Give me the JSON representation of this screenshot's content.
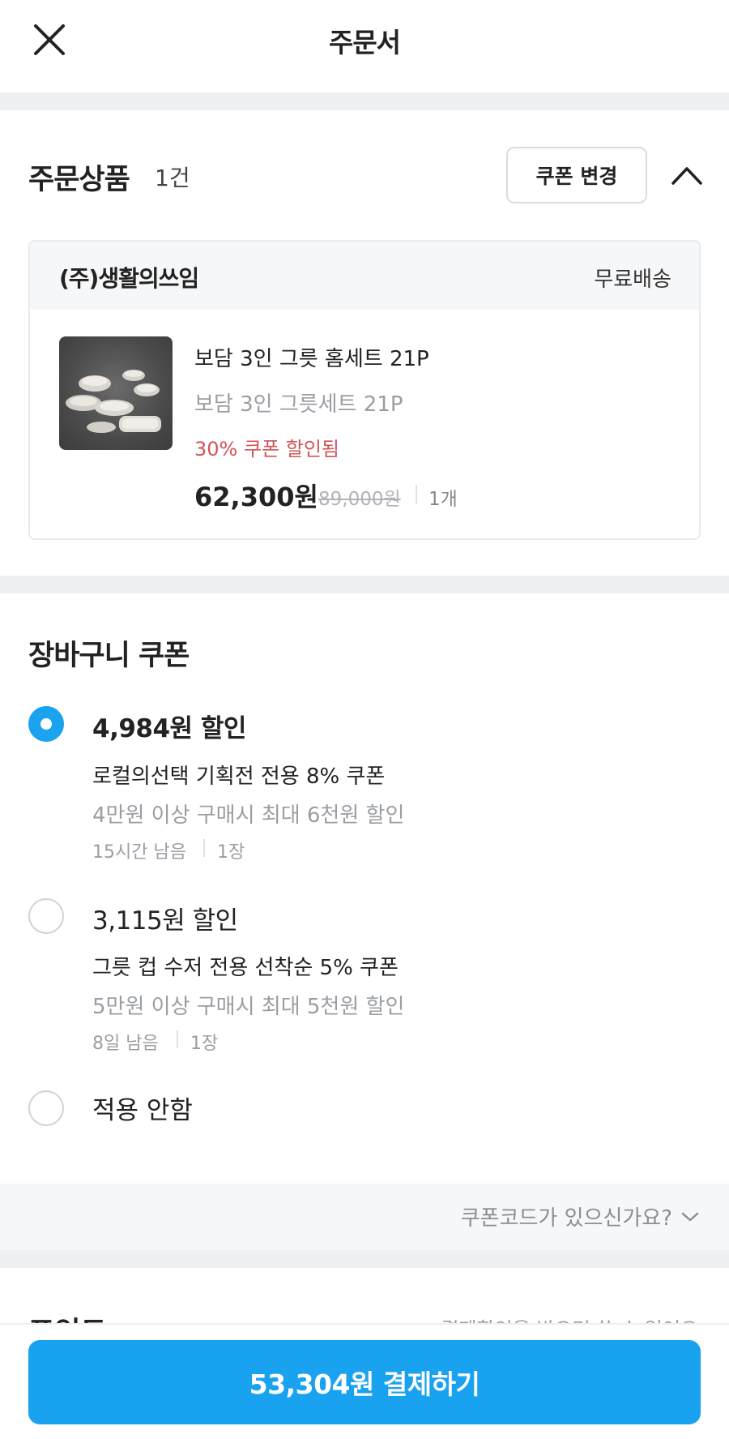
{
  "header": {
    "title": "주문서",
    "close_icon": "close-icon"
  },
  "order_product": {
    "title": "주문상품",
    "count": "1건",
    "coupon_change_label": "쿠폰 변경",
    "collapse_icon": "chevron-up-icon",
    "seller": "(주)생활의쓰임",
    "shipping": "무료배송",
    "item": {
      "name": "보담 3인 그릇 홈세트 21P",
      "option": "보담 3인 그릇세트 21P",
      "discount_note": "30% 쿠폰 할인됨",
      "price": "62,300원",
      "original_price": "89,000원",
      "quantity": "1개"
    }
  },
  "cart_coupon": {
    "title": "장바구니 쿠폰",
    "options": [
      {
        "amount": "4,984원 할인",
        "name": "로컬의선택 기획전 전용 8% 쿠폰",
        "condition": "4만원 이상 구매시 최대 6천원 할인",
        "remaining": "15시간 남음",
        "count": "1장",
        "selected": true
      },
      {
        "amount": "3,115원 할인",
        "name": "그릇 컵 수저 전용 선착순 5% 쿠폰",
        "condition": "5만원 이상 구매시 최대 5천원 할인",
        "remaining": "8일 남음",
        "count": "1장",
        "selected": false
      }
    ],
    "no_apply_label": "적용 안함",
    "code_link": "쿠폰코드가 있으신가요?",
    "code_link_icon": "chevron-down-icon"
  },
  "points": {
    "title": "포인트",
    "note": "결제할인을 받으면 쓸 수 없어요"
  },
  "pay_button_label": "53,304원 결제하기",
  "colors": {
    "accent": "#19a2ef",
    "discount_red": "#d0555a",
    "divider": "#eef1f4"
  }
}
